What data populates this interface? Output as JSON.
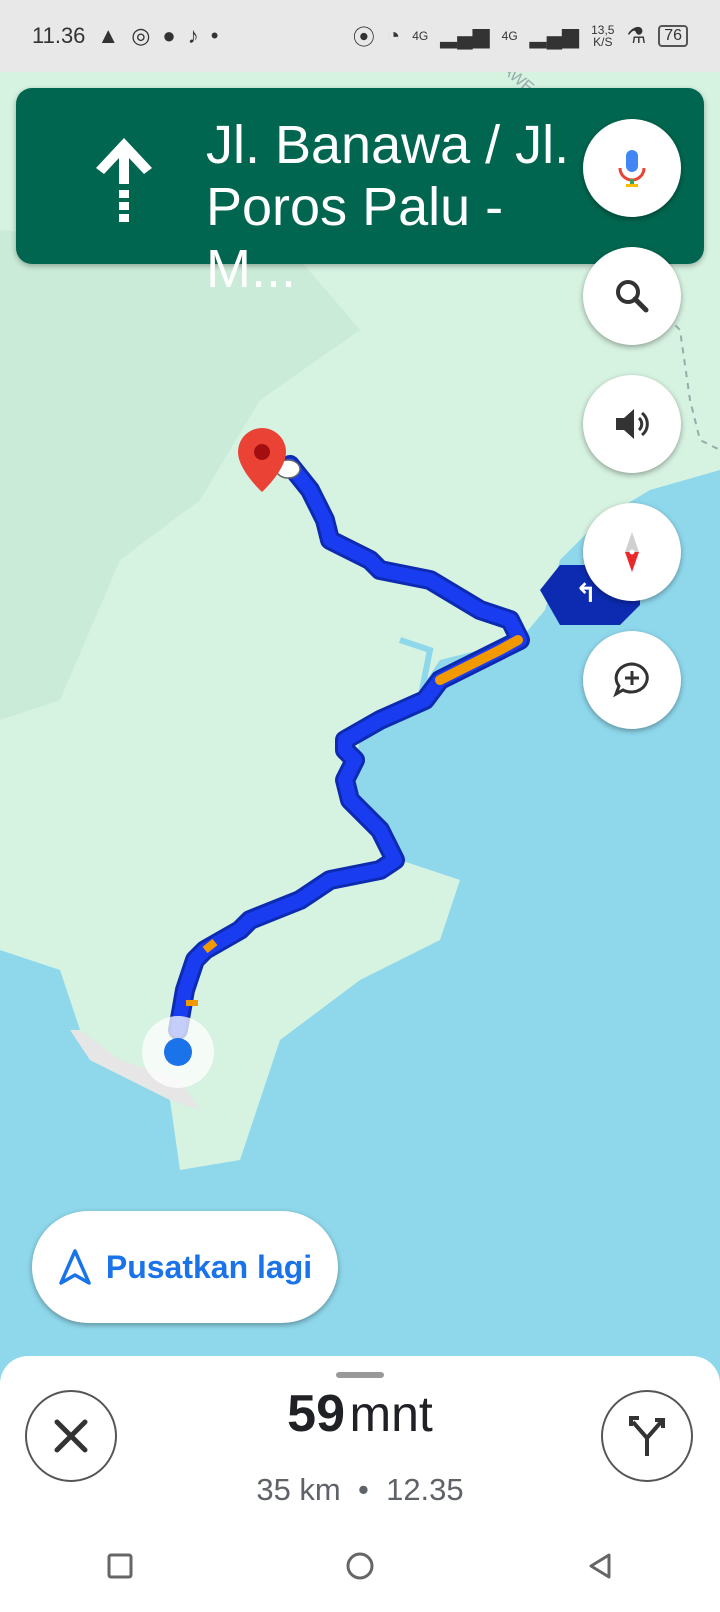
{
  "status_bar": {
    "time": "11.36",
    "network_1": "4G",
    "network_2": "4G",
    "speed_value": "13,5",
    "speed_unit": "K/S",
    "battery": "76",
    "map_label": "SULAWE"
  },
  "navigation": {
    "direction_icon": "straight-arrow-icon",
    "street": "Jl. Banawa / Jl.\nPoros Palu - M..."
  },
  "map_buttons": [
    "mic-icon",
    "search-icon",
    "volume-icon",
    "compass-icon",
    "add-report-icon"
  ],
  "recenter": {
    "label": "Pusatkan lagi"
  },
  "trip": {
    "duration_value": "59",
    "duration_unit": "mnt",
    "distance": "35 km",
    "separator": "•",
    "arrival": "12.35"
  },
  "colors": {
    "banner": "#00664f",
    "route": "#1a3cf0",
    "traffic": "#f29900",
    "water": "#8fd8ec",
    "land": "#d6f2e1"
  }
}
